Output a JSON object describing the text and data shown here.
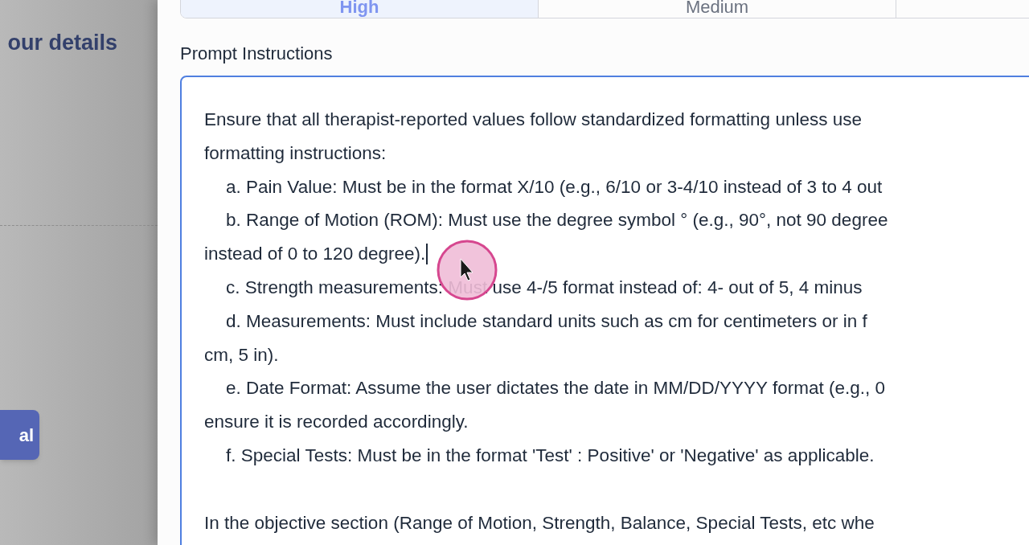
{
  "backdrop": {
    "heading": "our details",
    "button": "al"
  },
  "priority_options": [
    {
      "label": "High",
      "selected": true
    },
    {
      "label": "Medium",
      "selected": false
    }
  ],
  "prompt": {
    "label": "Prompt Instructions",
    "focused": true,
    "lines": [
      {
        "kind": "plain",
        "text": "Ensure that all therapist-reported values follow standardized formatting unless use",
        "caret": false
      },
      {
        "kind": "plain",
        "text": "formatting instructions:",
        "caret": false
      },
      {
        "kind": "item",
        "text": "a. Pain Value: Must be in the format X/10 (e.g., 6/10 or 3-4/10 instead of 3 to 4 out",
        "caret": false
      },
      {
        "kind": "item",
        "text": "b. Range of Motion (ROM): Must use the degree symbol ° (e.g., 90°, not 90 degree",
        "caret": false
      },
      {
        "kind": "plain",
        "text": "instead of 0 to 120 degree).",
        "caret": true
      },
      {
        "kind": "item",
        "text": "c. Strength measurements: Must use 4-/5 format instead of: 4- out of 5, 4 minus",
        "caret": false
      },
      {
        "kind": "item",
        "text": "d. Measurements: Must include standard units such as cm for centimeters or in f",
        "caret": false
      },
      {
        "kind": "plain",
        "text": "cm, 5 in).",
        "caret": false
      },
      {
        "kind": "item",
        "text": "e. Date Format: Assume the user dictates the date in MM/DD/YYYY format (e.g., 0",
        "caret": false
      },
      {
        "kind": "plain",
        "text": "ensure it is recorded accordingly.",
        "caret": false
      },
      {
        "kind": "item",
        "text": "f. Special Tests: Must be in the format 'Test' : Positive' or 'Negative' as applicable.",
        "caret": false
      },
      {
        "kind": "blank"
      },
      {
        "kind": "plain",
        "text": "In the objective section (Range of Motion, Strength, Balance, Special Tests, etc whe",
        "caret": false
      }
    ]
  }
}
